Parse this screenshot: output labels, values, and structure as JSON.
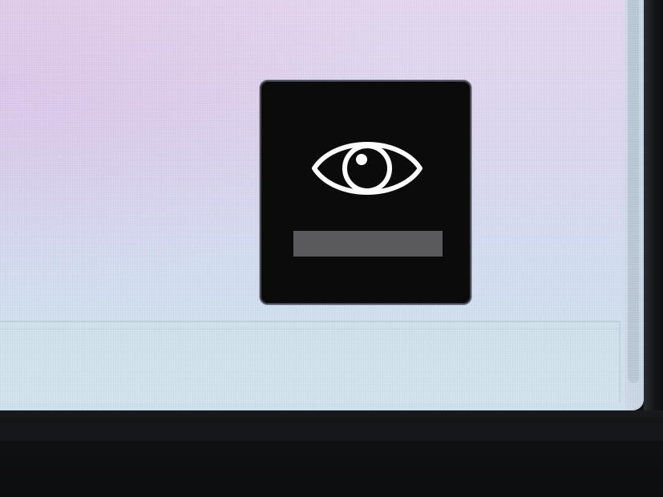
{
  "hud": {
    "icon": "eye-icon",
    "level_percent": 100,
    "colors": {
      "background": "#0b0b0c",
      "icon": "#ffffff",
      "bar": "#5a5a5c"
    }
  },
  "screen": {
    "scrollbar": "vertical"
  }
}
